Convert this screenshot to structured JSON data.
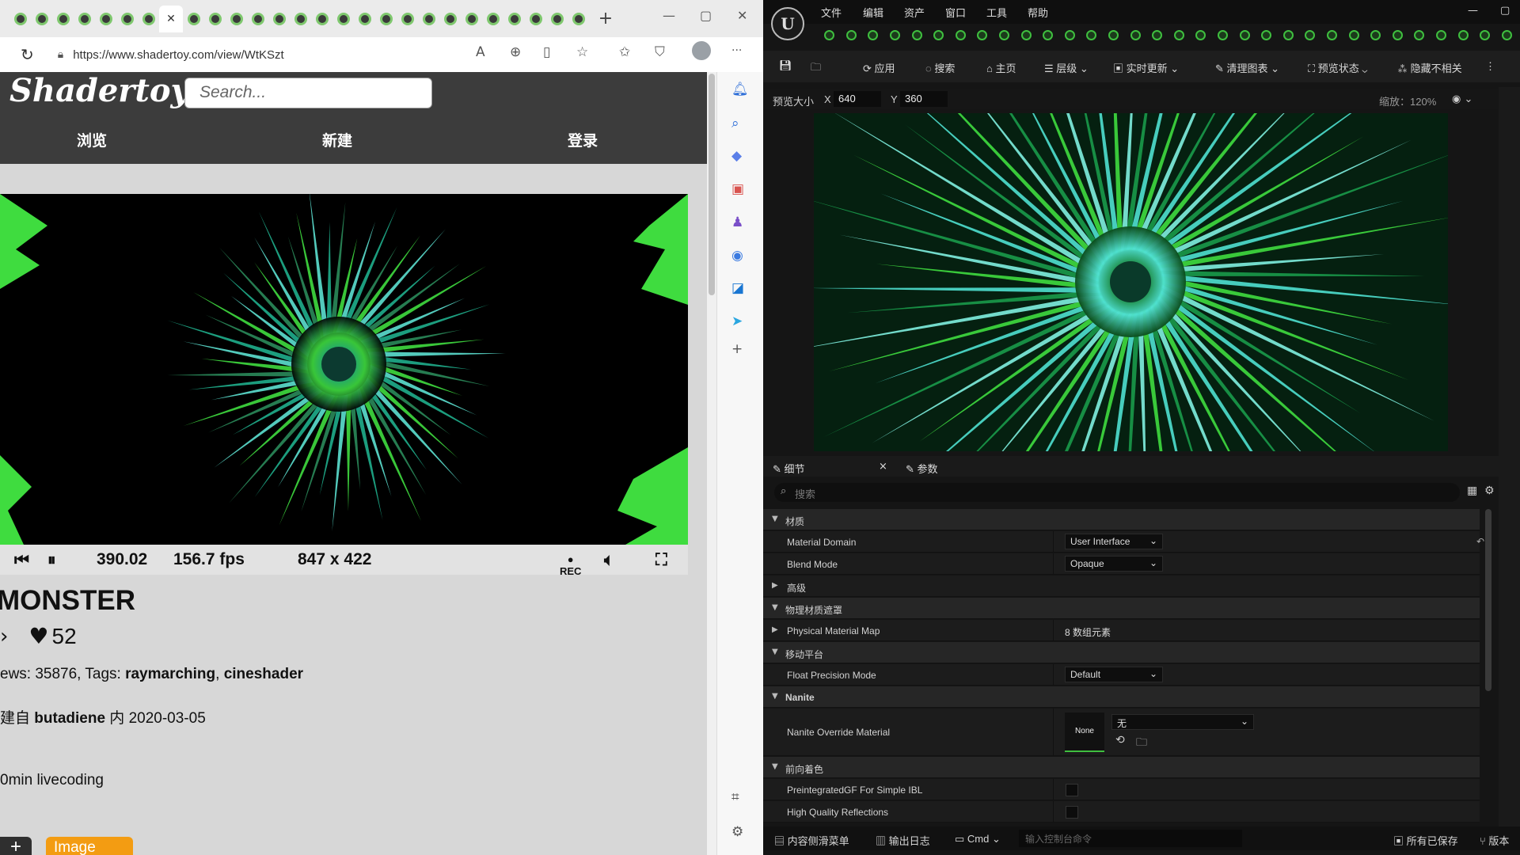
{
  "browser": {
    "tabs_count": 27,
    "new_tab": "+",
    "window_controls": [
      "—",
      "▢",
      "✕"
    ],
    "address": "https://www.shadertoy.com/view/WtKSzt",
    "address_icons": [
      "read-aloud-icon",
      "zoom-icon",
      "split-screen-icon",
      "favorite-icon",
      "favorites-bar-icon",
      "collections-icon",
      "profile-icon",
      "more-icon"
    ],
    "more": "···"
  },
  "shadertoy": {
    "logo": "Shadertoy",
    "search_placeholder": "Search...",
    "nav": {
      "browse": "浏览",
      "new": "新建",
      "login": "登录"
    },
    "controls": {
      "time": "390.02",
      "fps": "156.7 fps",
      "resolution": "847 x 422",
      "rec": "REC"
    },
    "title": "MONSTER",
    "likes": "52",
    "views_prefix": "ews: 35876, Tags: ",
    "tag1": "raymarching",
    "tag_sep": ", ",
    "tag2": "cineshader",
    "author_prefix": "建自 ",
    "author": "butadiene",
    "author_mid": " 内 ",
    "date": "2020-03-05",
    "description": "0min livecoding",
    "add_button": "+",
    "image_button": "Image"
  },
  "unreal": {
    "menu": {
      "file": "文件",
      "edit": "编辑",
      "asset": "资产",
      "window": "窗口",
      "tools": "工具",
      "help": "帮助"
    },
    "toolbar": {
      "apply": "应用",
      "search": "搜索",
      "home": "主页",
      "hierarchy": "层级",
      "live_update": "实时更新",
      "clean_graph": "清理图表",
      "preview_state": "预览状态",
      "hide_unrelated": "隐藏不相关"
    },
    "preview": {
      "size_label": "预览大小",
      "x_label": "X",
      "x": "640",
      "y_label": "Y",
      "y": "360",
      "zoom": "缩放：120%"
    },
    "details_tab": "细节",
    "params_tab": "参数",
    "search_placeholder": "搜索",
    "rows": {
      "material": "材质",
      "material_domain": "Material Domain",
      "material_domain_value": "User Interface",
      "blend_mode": "Blend Mode",
      "blend_mode_value": "Opaque",
      "advanced": "高级",
      "phys_mask": "物理材质遮罩",
      "phys_map": "Physical Material Map",
      "phys_map_value": "8 数组元素",
      "mobile": "移动平台",
      "float_precision": "Float Precision Mode",
      "float_precision_value": "Default",
      "nanite": "Nanite",
      "nanite_override": "Nanite Override Material",
      "nanite_none": "None",
      "nanite_value": "无",
      "forward": "前向着色",
      "preintegrated": "PreintegratedGF For Simple IBL",
      "hq_reflections": "High Quality Reflections"
    },
    "status": {
      "drawer": "内容侧滑菜单",
      "output_log": "输出日志",
      "cmd": "Cmd",
      "cmd_placeholder": "输入控制台命令",
      "saved": "所有已保存",
      "version": "版本"
    }
  },
  "colors": {
    "shader_green": "#3fdc3f",
    "shader_cyan": "#5ce0d0",
    "ue_bg": "#151515",
    "st_header": "#3c3c3c",
    "image_btn": "#f39c12"
  }
}
